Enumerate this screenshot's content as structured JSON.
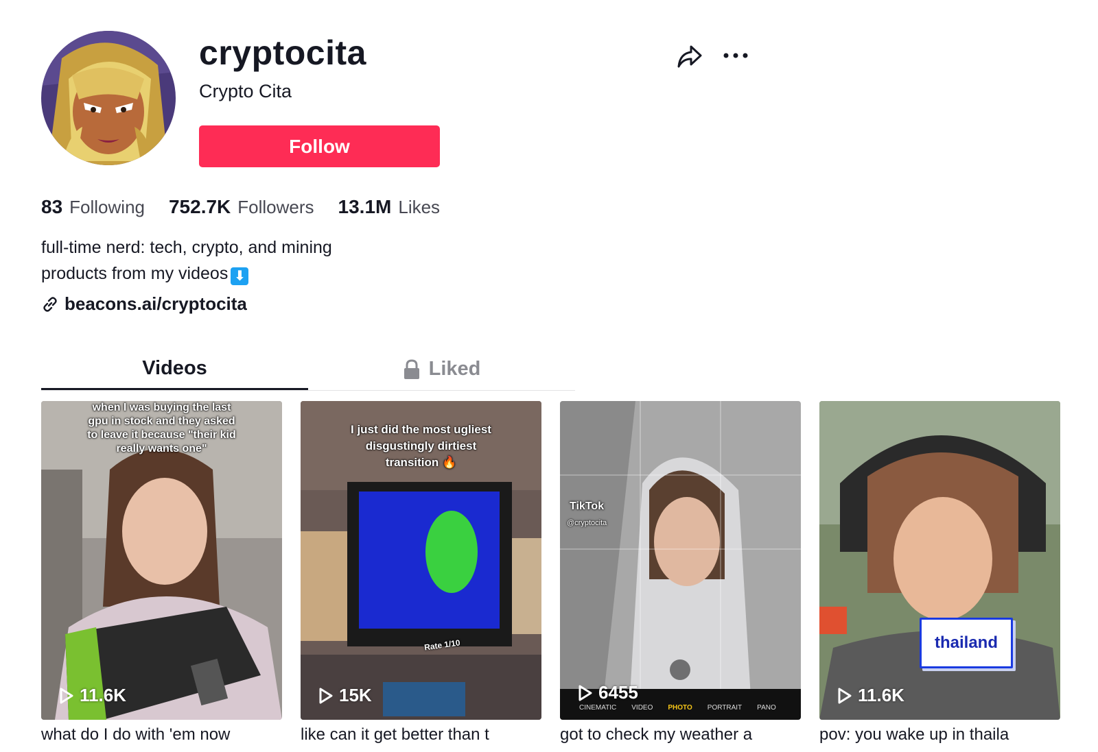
{
  "profile": {
    "username": "cryptocita",
    "nickname": "Crypto Cita",
    "follow_label": "Follow"
  },
  "stats": {
    "following_count": "83",
    "following_label": "Following",
    "followers_count": "752.7K",
    "followers_label": "Followers",
    "likes_count": "13.1M",
    "likes_label": "Likes"
  },
  "bio": {
    "line1": "full-time nerd: tech, crypto, and mining",
    "line2": "products from my videos",
    "emoji": "⬇"
  },
  "link": {
    "text": "beacons.ai/cryptocita"
  },
  "tabs": [
    {
      "label": "Videos",
      "active": true
    },
    {
      "label": "Liked",
      "active": false
    }
  ],
  "videos": [
    {
      "overlay": "when I was buying the last gpu in stock and they asked to leave it because \"their kid really wants one\"",
      "views": "11.6K",
      "caption": "what do I do with 'em now"
    },
    {
      "overlay": "I just did the most ugliest disgustingly dirtiest transition 🔥",
      "views": "15K",
      "caption": "like can it get better than t"
    },
    {
      "overlay": "TikTok",
      "handle": "@cryptocita",
      "camera_modes": [
        "CINEMATIC",
        "VIDEO",
        "PHOTO",
        "PORTRAIT",
        "PANO"
      ],
      "views": "6455",
      "caption": "got to check my weather a"
    },
    {
      "overlay": "thailand",
      "views": "11.6K",
      "caption": "pov: you wake up in thaila"
    }
  ],
  "video2_tag": "Rate 1/10",
  "colors": {
    "accent": "#fe2c55",
    "text": "#161823",
    "muted": "#8a8b91"
  }
}
